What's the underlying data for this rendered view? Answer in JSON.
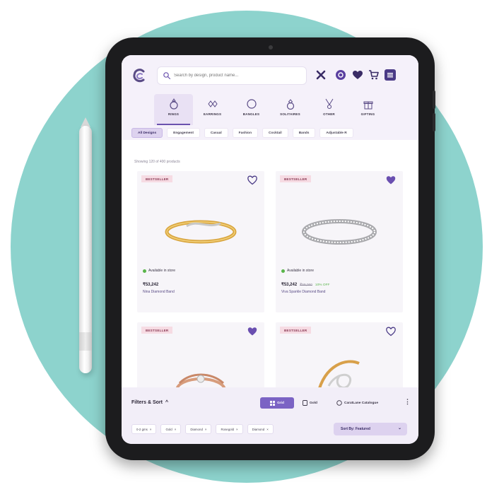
{
  "header": {
    "search_placeholder": "Search by design, product name...",
    "icons": [
      "logo",
      "search-icon",
      "diamond-icon",
      "account-icon",
      "heart-icon",
      "cart-icon",
      "menu-icon"
    ]
  },
  "categories": [
    {
      "label": "RINGS",
      "active": true
    },
    {
      "label": "EARRINGS",
      "active": false
    },
    {
      "label": "BANGLES",
      "active": false
    },
    {
      "label": "SOLITAIRES",
      "active": false
    },
    {
      "label": "OTHER",
      "active": false
    },
    {
      "label": "GIFTING",
      "active": false
    }
  ],
  "chips": [
    "All Designs",
    "Engagement",
    "Casual",
    "Fashion",
    "Cocktail",
    "Bands",
    "Adjustable R"
  ],
  "showing": "Showing 120 of 400 products",
  "products": [
    {
      "badge": "BESTSELLER",
      "stock": "Available in store",
      "price": "₹53,242",
      "mrp": "",
      "off": "",
      "name": "Nina Diamond Band",
      "favorited": false
    },
    {
      "badge": "BESTSELLER",
      "stock": "Available in store",
      "price": "₹53,242",
      "mrp": "₹59,060",
      "off": "10% OFF",
      "name": "Viva Sparkle Diamond Band",
      "favorited": true
    },
    {
      "badge": "BESTSELLER",
      "favorited": true
    },
    {
      "badge": "BESTSELLER",
      "favorited": false
    }
  ],
  "bottom": {
    "title": "Filters & Sort",
    "grid_label": "Grid",
    "gold_label": "Gold",
    "catalogue_label": "CaratLane Catalogue",
    "filters": [
      "0-2 gms",
      "Gold",
      "Diamond",
      "Rosegold",
      "Diamond"
    ],
    "sort_label": "Sort By: Featured"
  },
  "colors": {
    "teal": "#8dd3cd",
    "purple": "#6b52ae",
    "heart_fill": "#6a4fb0",
    "badge_bg": "#f6dbe3"
  }
}
